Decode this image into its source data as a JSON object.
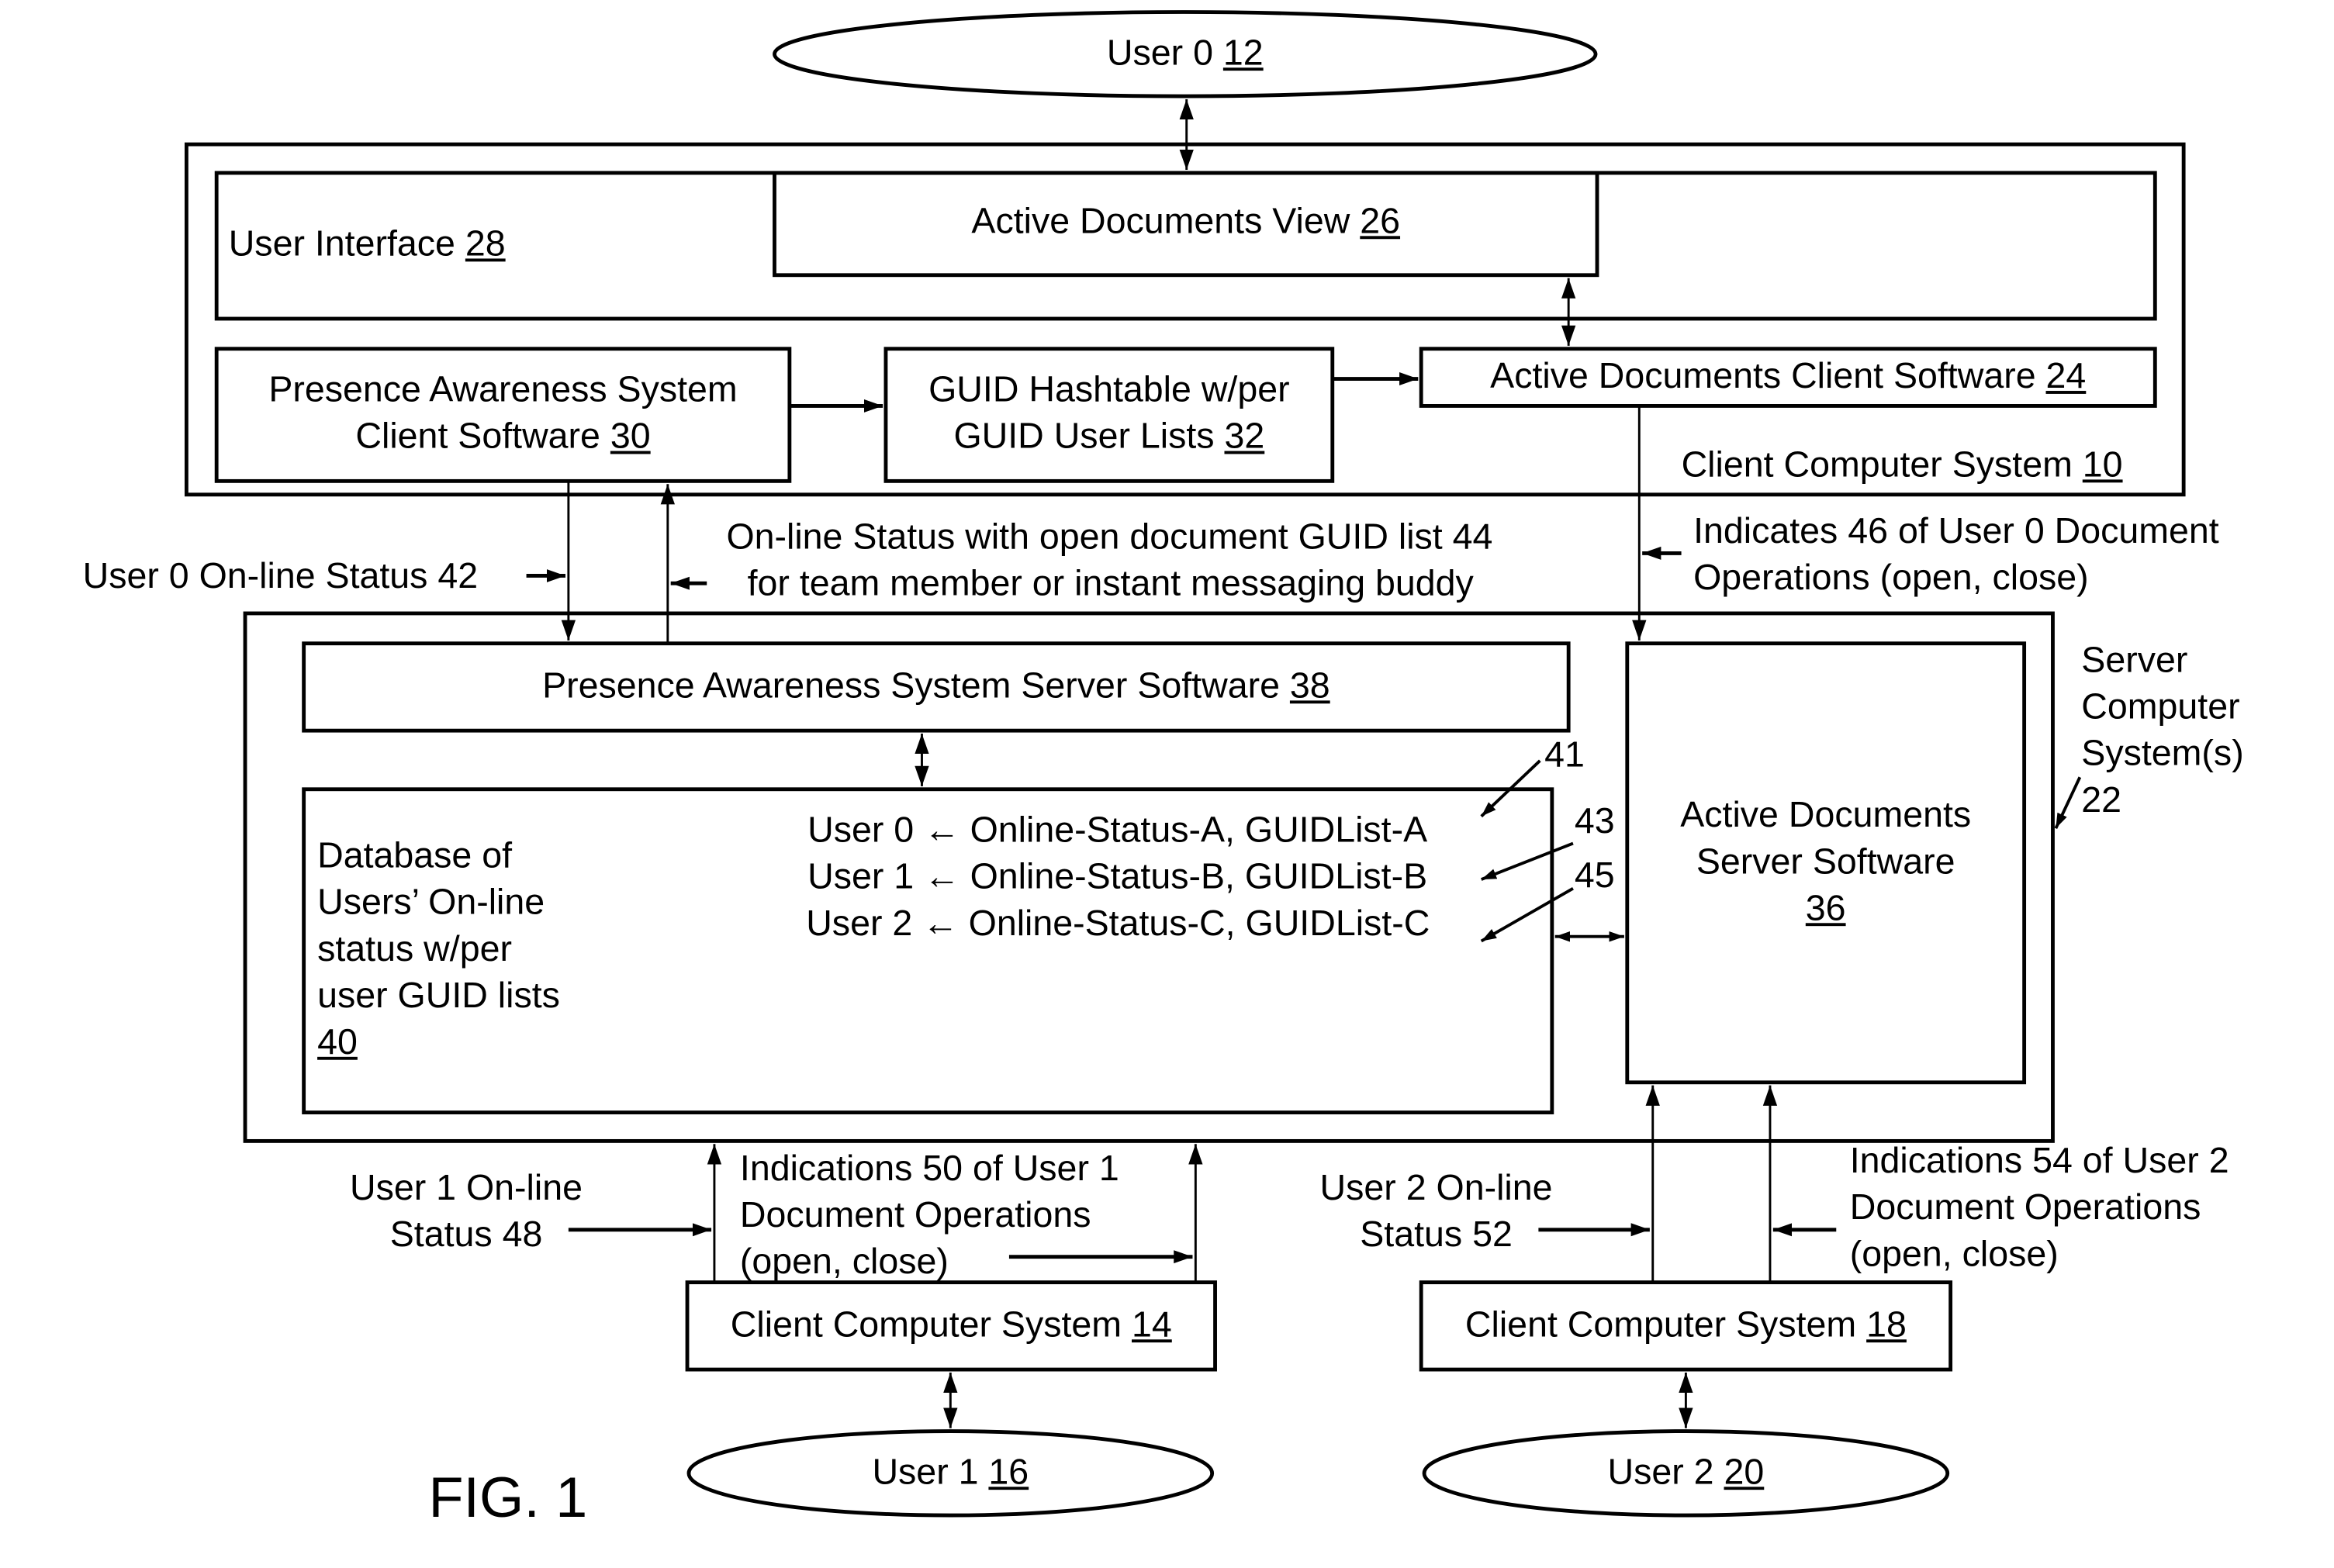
{
  "figure": {
    "label": "FIG. 1"
  },
  "users": {
    "user0": {
      "name": "User 0",
      "ref": "12"
    },
    "user1": {
      "name": "User 1",
      "ref": "16"
    },
    "user2": {
      "name": "User 2",
      "ref": "20"
    }
  },
  "client_system_10": {
    "label": "Client Computer System",
    "ref": "10",
    "user_interface": {
      "label": "User Interface",
      "ref": "28"
    },
    "active_documents_view": {
      "label": "Active Documents View",
      "ref": "26"
    },
    "pas_client": {
      "line1": "Presence Awareness System",
      "line2": "Client Software",
      "ref": "30"
    },
    "guid_hashtable": {
      "line1": "GUID Hashtable w/per",
      "line2": "GUID User Lists",
      "ref": "32"
    },
    "ad_client": {
      "label": "Active Documents Client Software",
      "ref": "24"
    }
  },
  "server_system": {
    "line1": "Server",
    "line2": "Computer",
    "line3": "System(s)",
    "ref": "22",
    "pas_server": {
      "label": "Presence Awareness System Server Software",
      "ref": "38"
    },
    "database": {
      "lines": [
        "Database of",
        "Users’ On-line",
        "status w/per",
        "user GUID lists"
      ],
      "ref": "40",
      "entries": [
        {
          "text": "User 0 ← Online-Status-A, GUIDList-A",
          "ref": "41"
        },
        {
          "text": "User 1 ← Online-Status-B, GUIDList-B",
          "ref": "43"
        },
        {
          "text": "User 2 ← Online-Status-C, GUIDList-C",
          "ref": "45"
        }
      ]
    },
    "ad_server": {
      "line1": "Active Documents",
      "line2": "Server Software",
      "ref": "36"
    }
  },
  "flows": {
    "user0_status": "User 0 On-line Status 42",
    "status_with_guid_line1": "On-line Status with open document GUID list 44",
    "status_with_guid_line2": "for team member or instant messaging buddy",
    "indicates46_line1": "Indicates 46 of User 0 Document",
    "indicates46_line2": "Operations (open, close)",
    "user1_status_line1": "User 1 On-line",
    "user1_status_line2": "Status 48",
    "indications50_line1": "Indications 50 of User 1",
    "indications50_line2": "Document Operations",
    "indications50_line3": "(open, close)",
    "user2_status_line1": "User 2 On-line",
    "user2_status_line2": "Status 52",
    "indications54_line1": "Indications 54 of User 2",
    "indications54_line2": "Document Operations",
    "indications54_line3": "(open, close)"
  },
  "client_14": {
    "label": "Client Computer System",
    "ref": "14"
  },
  "client_18": {
    "label": "Client Computer System",
    "ref": "18"
  }
}
